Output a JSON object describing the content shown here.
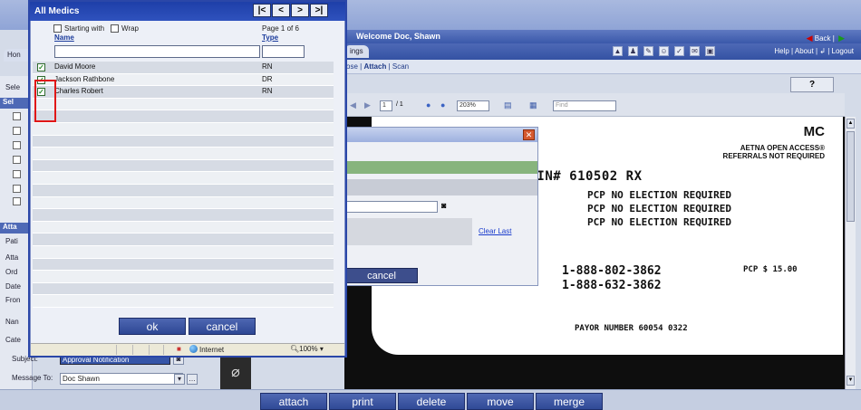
{
  "app": {
    "welcome": "Welcome Doc, Shawn",
    "back_label": "Back |",
    "home_tab": "Hon",
    "settings_tab": "ings",
    "top_links": "Help | About | ↲ | Logout",
    "subbar_prefix": "ose |",
    "subbar_attach": "Attach",
    "subbar_scan": "| Scan",
    "help_button": "?"
  },
  "left_panel": {
    "sele_label": "Sele",
    "sel_header": "Sel",
    "att_header": "Atta",
    "labels": [
      "Pati",
      "Atta",
      "Ord",
      "Date",
      "Fron",
      "Nan",
      "Cate"
    ]
  },
  "pdf_toolbar": {
    "page_current": "1",
    "page_total": "/ 1",
    "zoom": "203%",
    "find_placeholder": "Find"
  },
  "inner_dialog": {
    "clear_last": "Clear Last",
    "cancel": "cancel"
  },
  "card": {
    "plan_code": "MC",
    "aetna_line1": "AETNA OPEN ACCESS®",
    "aetna_line2": "REFERRALS NOT REQUIRED",
    "group_line": "RP: 564894-010-00700  BIN# 610502 RX",
    "pcp_lines": [
      "PCP  NO ELECTION REQUIRED",
      "PCP  NO ELECTION REQUIRED",
      "PCP  NO ELECTION REQUIRED"
    ],
    "phones": [
      "1-888-802-3862",
      "1-888-632-3862"
    ],
    "pcp_amount": "PCP $   15.00",
    "payor": "PAYOR NUMBER 60054 0322"
  },
  "lower_form": {
    "subject_label": "Subject:",
    "subject_value": "Approval Notification",
    "message_to_label": "Message To:",
    "message_to_value": "Doc Shawn"
  },
  "bottom_buttons": [
    "attach",
    "print",
    "delete",
    "move",
    "merge"
  ],
  "popup": {
    "title": "All Medics",
    "pager": [
      "|<",
      "<",
      ">",
      ">|"
    ],
    "starting_with": "Starting with",
    "wrap": "Wrap",
    "page_info": "Page 1 of 6",
    "col_name": "Name",
    "col_type": "Type",
    "rows": [
      {
        "name": "David Moore",
        "type": "RN",
        "checked": true
      },
      {
        "name": "Jackson Rathbone",
        "type": "DR",
        "checked": true
      },
      {
        "name": "Charles Robert",
        "type": "RN",
        "checked": true
      }
    ],
    "ok": "ok",
    "cancel": "cancel",
    "status_internet": "Internet",
    "status_zoom": "100%"
  }
}
